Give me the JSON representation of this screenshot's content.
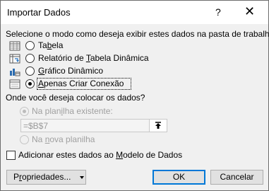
{
  "window": {
    "title": "Importar Dados",
    "help": "?",
    "close": "✕"
  },
  "instruction": "Selecione o modo como deseja exibir estes dados na pasta de trabalho.",
  "view_options": [
    {
      "pre": "Ta",
      "u": "b",
      "post": "ela",
      "icon": "table-icon",
      "checked": false
    },
    {
      "pre": "Relatório de ",
      "u": "T",
      "post": "abela Dinâmica",
      "icon": "pivot-table-icon",
      "checked": false
    },
    {
      "pre": "",
      "u": "G",
      "post": "ráfico Dinâmico",
      "icon": "pivot-chart-icon",
      "checked": false
    },
    {
      "pre": "",
      "u": "A",
      "post": "penas Criar Conexão",
      "icon": "connection-icon",
      "checked": true
    }
  ],
  "location_question": "Onde você deseja colocar os dados?",
  "existing_sheet": {
    "pre": "Na plan",
    "u": "i",
    "post": "lha existente:",
    "checked": true,
    "disabled": true
  },
  "cell_reference": "=$B$7",
  "new_sheet": {
    "pre": "Na ",
    "u": "n",
    "post": "ova planilha",
    "checked": false,
    "disabled": true
  },
  "data_model": {
    "pre": "Adicionar estes dados ao ",
    "u": "M",
    "post": "odelo de Dados",
    "checked": false
  },
  "buttons": {
    "properties": {
      "pre": "P",
      "u": "r",
      "post": "opriedades..."
    },
    "ok": "OK",
    "cancel": "Cancelar"
  }
}
